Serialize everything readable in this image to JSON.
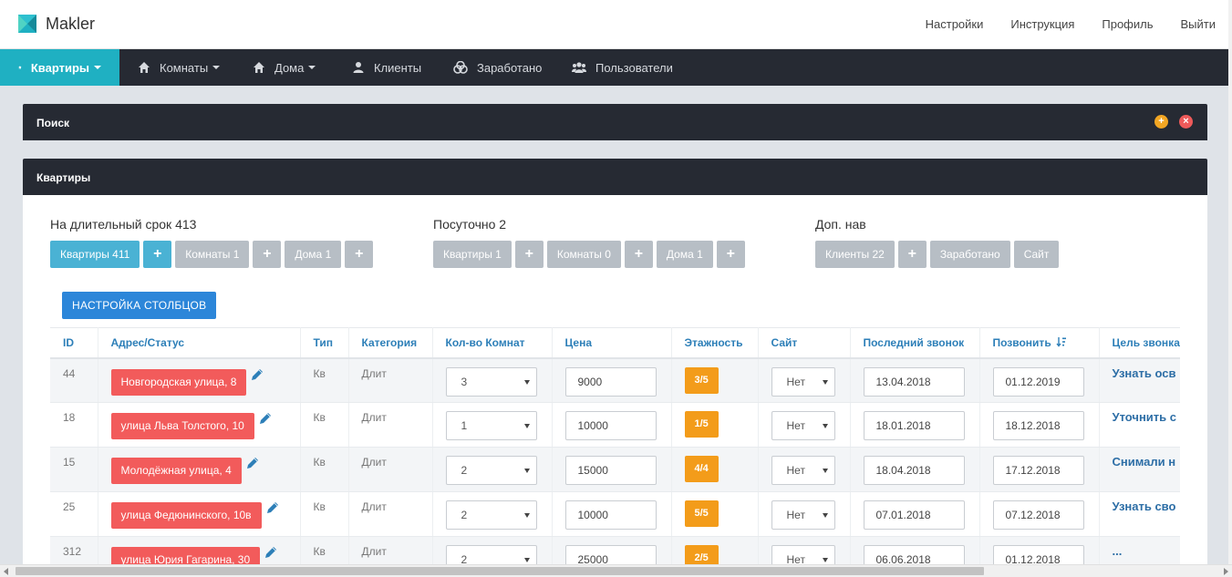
{
  "app": {
    "name": "Makler"
  },
  "top_links": [
    "Настройки",
    "Инструкция",
    "Профиль",
    "Выйти"
  ],
  "nav": [
    {
      "label": "Квартиры",
      "icon": "home-icon",
      "dropdown": true,
      "active": true
    },
    {
      "label": "Комнаты",
      "icon": "home-icon",
      "dropdown": true
    },
    {
      "label": "Дома",
      "icon": "home-icon",
      "dropdown": true
    },
    {
      "label": "Клиенты",
      "icon": "user-icon",
      "dropdown": false
    },
    {
      "label": "Заработано",
      "icon": "coins-icon",
      "dropdown": false
    },
    {
      "label": "Пользователи",
      "icon": "users-icon",
      "dropdown": false
    }
  ],
  "search_panel": {
    "title": "Поиск"
  },
  "apartments_panel": {
    "title": "Квартиры"
  },
  "groups": {
    "long_term": {
      "title": "На длительный срок 413",
      "buttons": [
        "Квартиры 411",
        "Комнаты 1",
        "Дома 1"
      ]
    },
    "daily": {
      "title": "Посуточно 2",
      "buttons": [
        "Квартиры 1",
        "Комнаты 0",
        "Дома 1"
      ]
    },
    "extra": {
      "title": "Доп. нав",
      "buttons": [
        "Клиенты 22",
        "Заработано",
        "Сайт"
      ]
    }
  },
  "plus_label": "+",
  "config_button": "НАСТРОЙКА СТОЛБЦОВ",
  "table": {
    "columns": [
      "ID",
      "Адрес/Статус",
      "Тип",
      "Категория",
      "Кол-во Комнат",
      "Цена",
      "Этажность",
      "Сайт",
      "Последний звонок",
      "Позвонить",
      "Цель звонка"
    ],
    "rows": [
      {
        "id": "44",
        "address": "Новгородская улица, 8",
        "type": "Кв",
        "category": "Длит",
        "rooms": "3",
        "price": "9000",
        "floors": "3/5",
        "site": "Нет",
        "last_call": "13.04.2018",
        "call": "01.12.2019",
        "goal": "Узнать осв"
      },
      {
        "id": "18",
        "address": "улица Льва Толстого, 10",
        "type": "Кв",
        "category": "Длит",
        "rooms": "1",
        "price": "10000",
        "floors": "1/5",
        "site": "Нет",
        "last_call": "18.01.2018",
        "call": "18.12.2018",
        "goal": "Уточнить с"
      },
      {
        "id": "15",
        "address": "Молодёжная улица, 4",
        "type": "Кв",
        "category": "Длит",
        "rooms": "2",
        "price": "15000",
        "floors": "4/4",
        "site": "Нет",
        "last_call": "18.04.2018",
        "call": "17.12.2018",
        "goal": "Снимали н"
      },
      {
        "id": "25",
        "address": "улица Федюнинского, 10в",
        "type": "Кв",
        "category": "Длит",
        "rooms": "2",
        "price": "10000",
        "floors": "5/5",
        "site": "Нет",
        "last_call": "07.01.2018",
        "call": "07.12.2018",
        "goal": "Узнать сво"
      },
      {
        "id": "312",
        "address": "улица Юрия Гагарина, 30",
        "type": "Кв",
        "category": "Длит",
        "rooms": "2",
        "price": "25000",
        "floors": "2/5",
        "site": "Нет",
        "last_call": "06.06.2018",
        "call": "01.12.2018",
        "goal": "..."
      }
    ]
  },
  "colors": {
    "accent": "#1fb0c2",
    "nav_bg": "#262a33",
    "address_badge": "#f25b5b",
    "floor_badge": "#f39c1a",
    "primary_button": "#4ab2d4",
    "config_button": "#2c86d9",
    "header_text": "#2d7fb8"
  }
}
